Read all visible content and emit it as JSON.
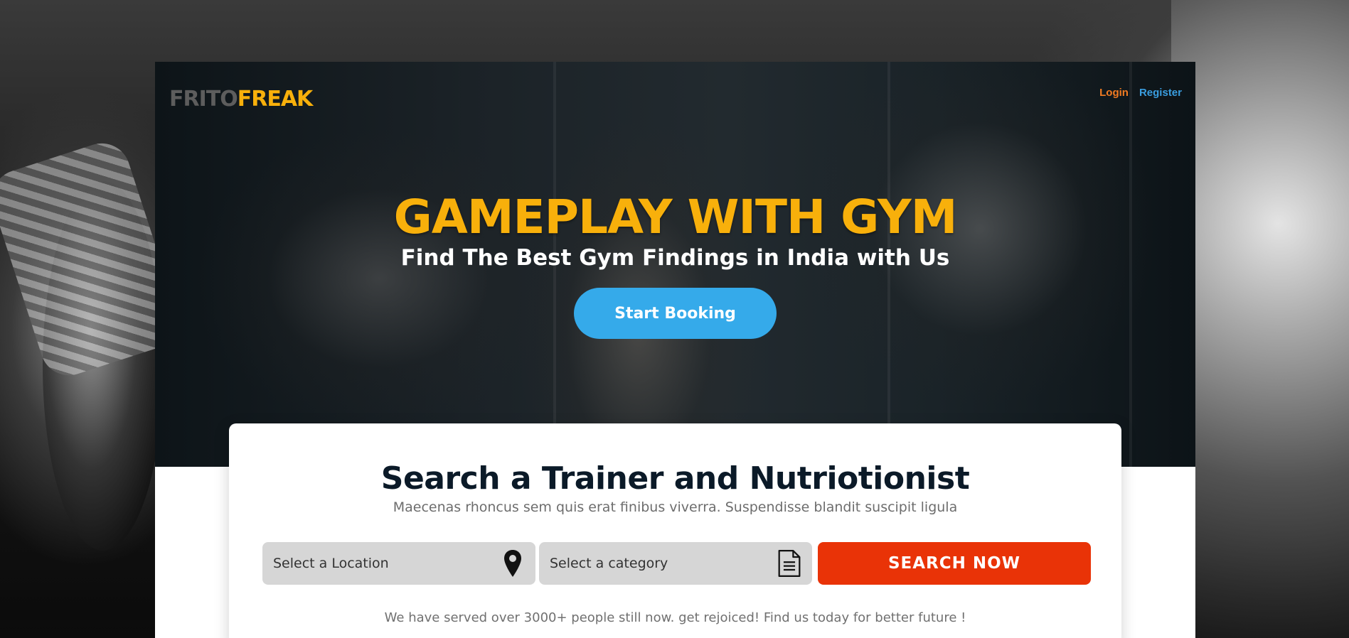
{
  "brand": {
    "logo_part1": "FRITO",
    "logo_part2": "FREAK"
  },
  "nav": {
    "login": "Login",
    "register": "Register"
  },
  "hero": {
    "title": "GAMEPLAY WITH GYM",
    "subtitle": "Find The Best Gym Findings in India with Us",
    "cta_label": "Start Booking"
  },
  "search": {
    "title": "Search a Trainer and Nutriotionist",
    "description": "Maecenas rhoncus sem quis erat finibus viverra. Suspendisse blandit suscipit ligula",
    "location_placeholder": "Select a Location",
    "location_icon": "map-pin-icon",
    "category_placeholder": "Select a category",
    "category_icon": "document-icon",
    "button_label": "SEARCH NOW",
    "footer_text": "We have served over 3000+ people still now. get rejoiced! Find us today for better future !"
  },
  "colors": {
    "accent_yellow": "#f8b00b",
    "login_orange": "#f27b22",
    "register_blue": "#3a9ee0",
    "cta_blue": "#35aaea",
    "search_red": "#e93307",
    "heading_navy": "#0b1a28"
  }
}
